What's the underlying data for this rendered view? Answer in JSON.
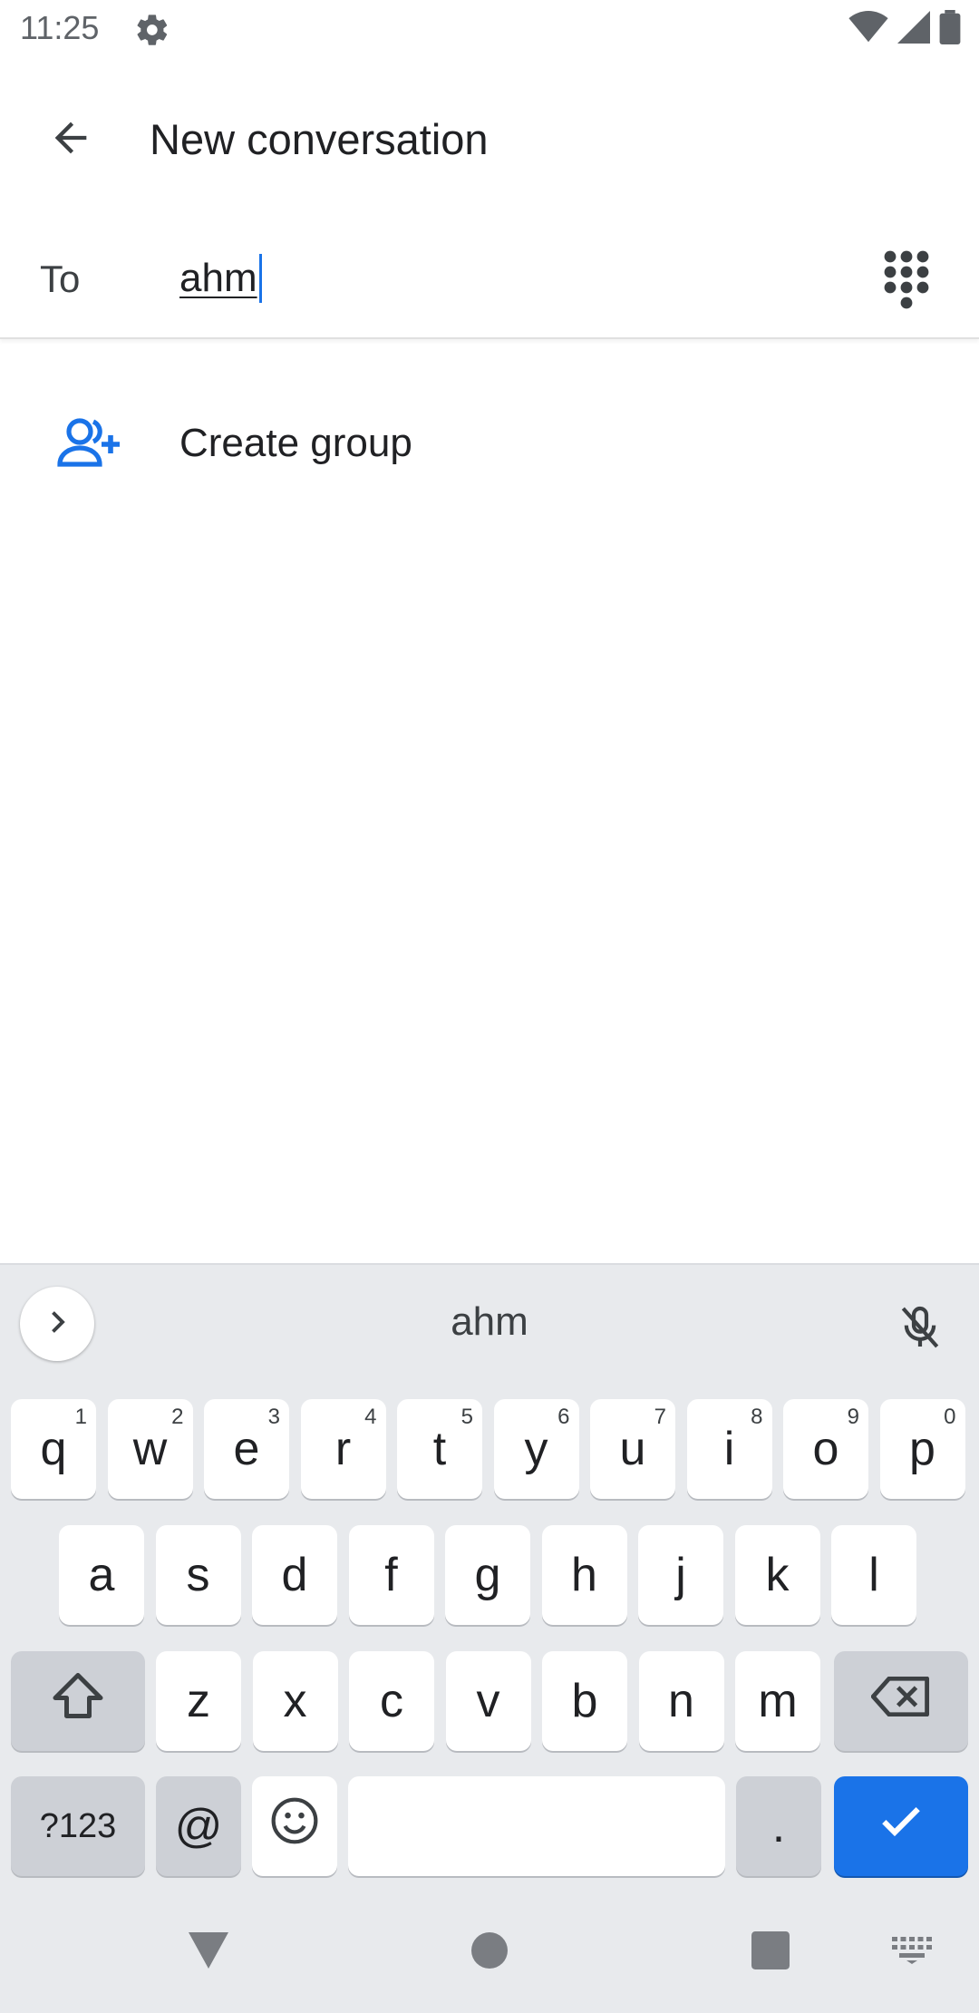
{
  "status_bar": {
    "time": "11:25"
  },
  "app_bar": {
    "title": "New conversation"
  },
  "to_row": {
    "label": "To",
    "value": "ahm"
  },
  "create_group": {
    "label": "Create group"
  },
  "keyboard": {
    "suggestion": "ahm",
    "row1": [
      {
        "k": "q",
        "h": "1"
      },
      {
        "k": "w",
        "h": "2"
      },
      {
        "k": "e",
        "h": "3"
      },
      {
        "k": "r",
        "h": "4"
      },
      {
        "k": "t",
        "h": "5"
      },
      {
        "k": "y",
        "h": "6"
      },
      {
        "k": "u",
        "h": "7"
      },
      {
        "k": "i",
        "h": "8"
      },
      {
        "k": "o",
        "h": "9"
      },
      {
        "k": "p",
        "h": "0"
      }
    ],
    "row2": [
      "a",
      "s",
      "d",
      "f",
      "g",
      "h",
      "j",
      "k",
      "l"
    ],
    "row3": [
      "z",
      "x",
      "c",
      "v",
      "b",
      "n",
      "m"
    ],
    "symbols_label": "?123",
    "at_label": "@",
    "period_label": "."
  },
  "colors": {
    "accent": "#1a73e8",
    "keyboard_bg": "#e8eaed",
    "key_dark": "#cdd0d6"
  }
}
